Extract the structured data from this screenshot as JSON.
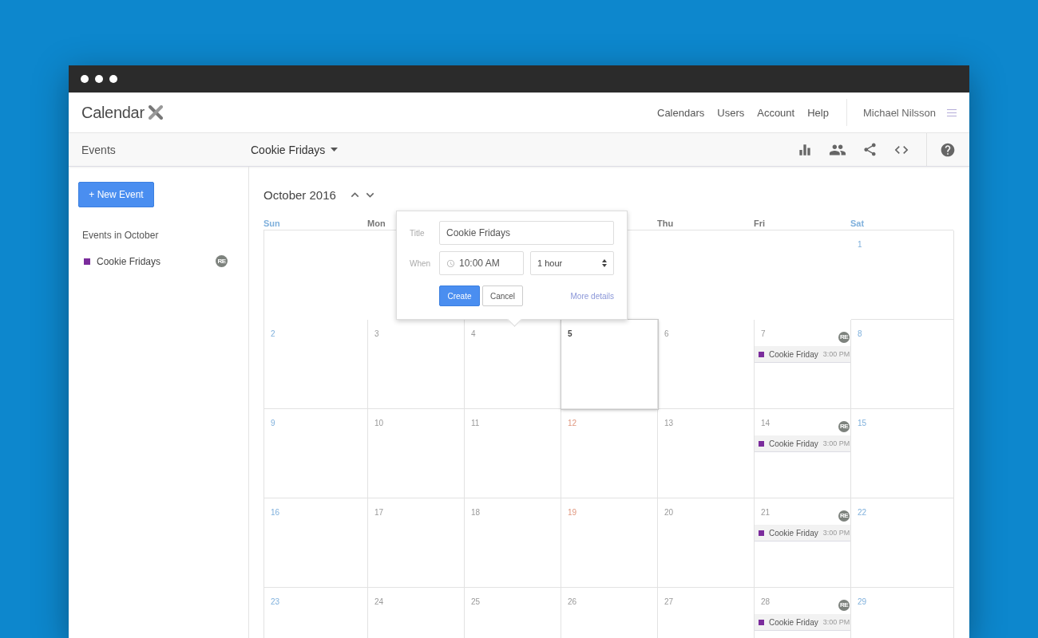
{
  "header": {
    "logo": "Calendar",
    "nav": [
      "Calendars",
      "Users",
      "Account",
      "Help"
    ],
    "user": "Michael Nilsson"
  },
  "toolbar": {
    "section": "Events",
    "calendar": "Cookie Fridays"
  },
  "sidebar": {
    "new_button": "+ New Event",
    "heading": "Events in October",
    "items": [
      {
        "label": "Cookie Fridays",
        "color": "#7b2c9c",
        "badge": "RE"
      }
    ]
  },
  "calendar": {
    "month": "October 2016",
    "weekdays": {
      "sun": {
        "label": "Sun",
        "kind": "weekend"
      },
      "mon": {
        "label": "Mon",
        "kind": "weekday"
      },
      "thu": {
        "label": "Thu",
        "kind": "weekday"
      },
      "fri": {
        "label": "Fri",
        "kind": "weekday"
      },
      "sat": {
        "label": "Sat",
        "kind": "weekend"
      }
    },
    "weeks": [
      {
        "sat": {
          "number": "1",
          "kind": "weekend",
          "selected": false
        }
      },
      {
        "sun": {
          "number": "2",
          "kind": "weekend",
          "selected": false
        },
        "mon": {
          "number": "3",
          "kind": "weekday",
          "selected": false
        },
        "tue": {
          "number": "4",
          "kind": "weekday",
          "selected": false
        },
        "wed": {
          "number": "5",
          "kind": "weekday",
          "selected": true
        },
        "thu": {
          "number": "6",
          "kind": "weekday",
          "selected": false
        },
        "fri": {
          "number": "7",
          "kind": "weekday",
          "selected": false,
          "events": [
            {
              "title": "Cookie Friday",
              "time": "3:00 PM",
              "color": "#7b2c9c",
              "badge": "RE"
            }
          ]
        },
        "sat": {
          "number": "8",
          "kind": "weekend",
          "selected": false
        }
      },
      {
        "sun": {
          "number": "9",
          "kind": "weekend",
          "selected": false
        },
        "mon": {
          "number": "10",
          "kind": "weekday",
          "selected": false
        },
        "tue": {
          "number": "11",
          "kind": "weekday",
          "selected": false
        },
        "wed": {
          "number": "12",
          "kind": "accent",
          "selected": false
        },
        "thu": {
          "number": "13",
          "kind": "weekday",
          "selected": false
        },
        "fri": {
          "number": "14",
          "kind": "weekday",
          "selected": false,
          "events": [
            {
              "title": "Cookie Friday",
              "time": "3:00 PM",
              "color": "#7b2c9c",
              "badge": "RE"
            }
          ]
        },
        "sat": {
          "number": "15",
          "kind": "weekend",
          "selected": false
        }
      },
      {
        "sun": {
          "number": "16",
          "kind": "weekend",
          "selected": false
        },
        "mon": {
          "number": "17",
          "kind": "weekday",
          "selected": false
        },
        "tue": {
          "number": "18",
          "kind": "weekday",
          "selected": false
        },
        "wed": {
          "number": "19",
          "kind": "accent",
          "selected": false
        },
        "thu": {
          "number": "20",
          "kind": "weekday",
          "selected": false
        },
        "fri": {
          "number": "21",
          "kind": "weekday",
          "selected": false,
          "events": [
            {
              "title": "Cookie Friday",
              "time": "3:00 PM",
              "color": "#7b2c9c",
              "badge": "RE"
            }
          ]
        },
        "sat": {
          "number": "22",
          "kind": "weekend",
          "selected": false
        }
      },
      {
        "sun": {
          "number": "23",
          "kind": "weekend",
          "selected": false
        },
        "mon": {
          "number": "24",
          "kind": "weekday",
          "selected": false
        },
        "tue": {
          "number": "25",
          "kind": "weekday",
          "selected": false
        },
        "wed": {
          "number": "26",
          "kind": "weekday",
          "selected": false
        },
        "thu": {
          "number": "27",
          "kind": "weekday",
          "selected": false
        },
        "fri": {
          "number": "28",
          "kind": "weekday",
          "selected": false,
          "events": [
            {
              "title": "Cookie Friday",
              "time": "3:00 PM",
              "color": "#7b2c9c",
              "badge": "RE"
            }
          ]
        },
        "sat": {
          "number": "29",
          "kind": "weekend",
          "selected": false
        }
      }
    ]
  },
  "popup": {
    "title_label": "Title",
    "title_value": "Cookie Fridays",
    "when_label": "When",
    "time": "10:00 AM",
    "duration": "1 hour",
    "create": "Create",
    "cancel": "Cancel",
    "more": "More details"
  }
}
